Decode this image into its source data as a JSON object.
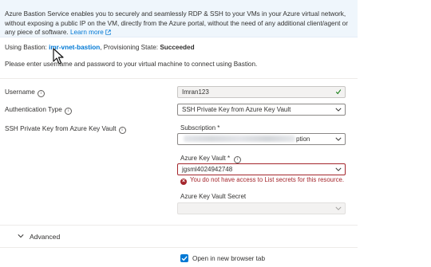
{
  "intro": {
    "text": "Azure Bastion Service enables you to securely and seamlessly RDP & SSH to your VMs in your Azure virtual network, without exposing a public IP on the VM, directly from the Azure portal, without the need of any additional client/agent or any piece of software.",
    "learn_more": "Learn more"
  },
  "status": {
    "using_label": "Using Bastion:",
    "bastion_name": "imr-vnet-bastion",
    "provisioning_label": ", Provisioning State:",
    "provisioning_state": "Succeeded"
  },
  "instructions": "Please enter username and password to your virtual machine to connect using Bastion.",
  "form": {
    "username_label": "Username",
    "username_value": "Imran123",
    "auth_type_label": "Authentication Type",
    "auth_type_value": "SSH Private Key from Azure Key Vault",
    "ssh_key_label": "SSH Private Key from Azure Key Vault",
    "subscription_label": "Subscription *",
    "subscription_value_visible": "ption",
    "key_vault_label": "Azure Key Vault *",
    "key_vault_value": "jgsml4024942748",
    "key_vault_error": "You do not have access to List secrets for this resource.",
    "key_vault_secret_label": "Azure Key Vault Secret"
  },
  "advanced": {
    "label": "Advanced"
  },
  "open_new_tab": {
    "label": "Open in new browser tab",
    "checked": true
  },
  "colors": {
    "accent": "#0078d4",
    "error": "#a4262c",
    "info_background": "#eff6fc"
  }
}
